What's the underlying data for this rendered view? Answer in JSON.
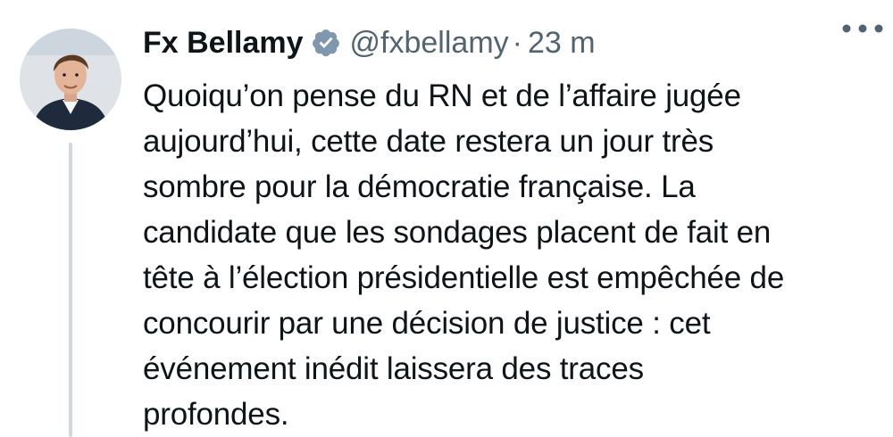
{
  "tweet": {
    "author_name": "Fx Bellamy",
    "handle": "@fxbellamy",
    "separator": "·",
    "time": "23 m",
    "verified_icon": "verified-badge-icon",
    "more_icon": "more-options-icon",
    "text_lines": [
      "Quoiqu’on pense du RN et de l’affaire jugée",
      "aujourd’hui, cette date restera un jour très",
      "sombre pour la démocratie française. La",
      "candidate que les sondages placent de fait en",
      "tête à l’élection présidentielle est empêchée de",
      "concourir par une décision de justice : cet",
      "événement inédit laissera des traces",
      "profondes."
    ]
  },
  "colors": {
    "text": "#0f1419",
    "secondary": "#536471",
    "verified": "#7f98b0",
    "thread_line": "#cfd9de"
  }
}
